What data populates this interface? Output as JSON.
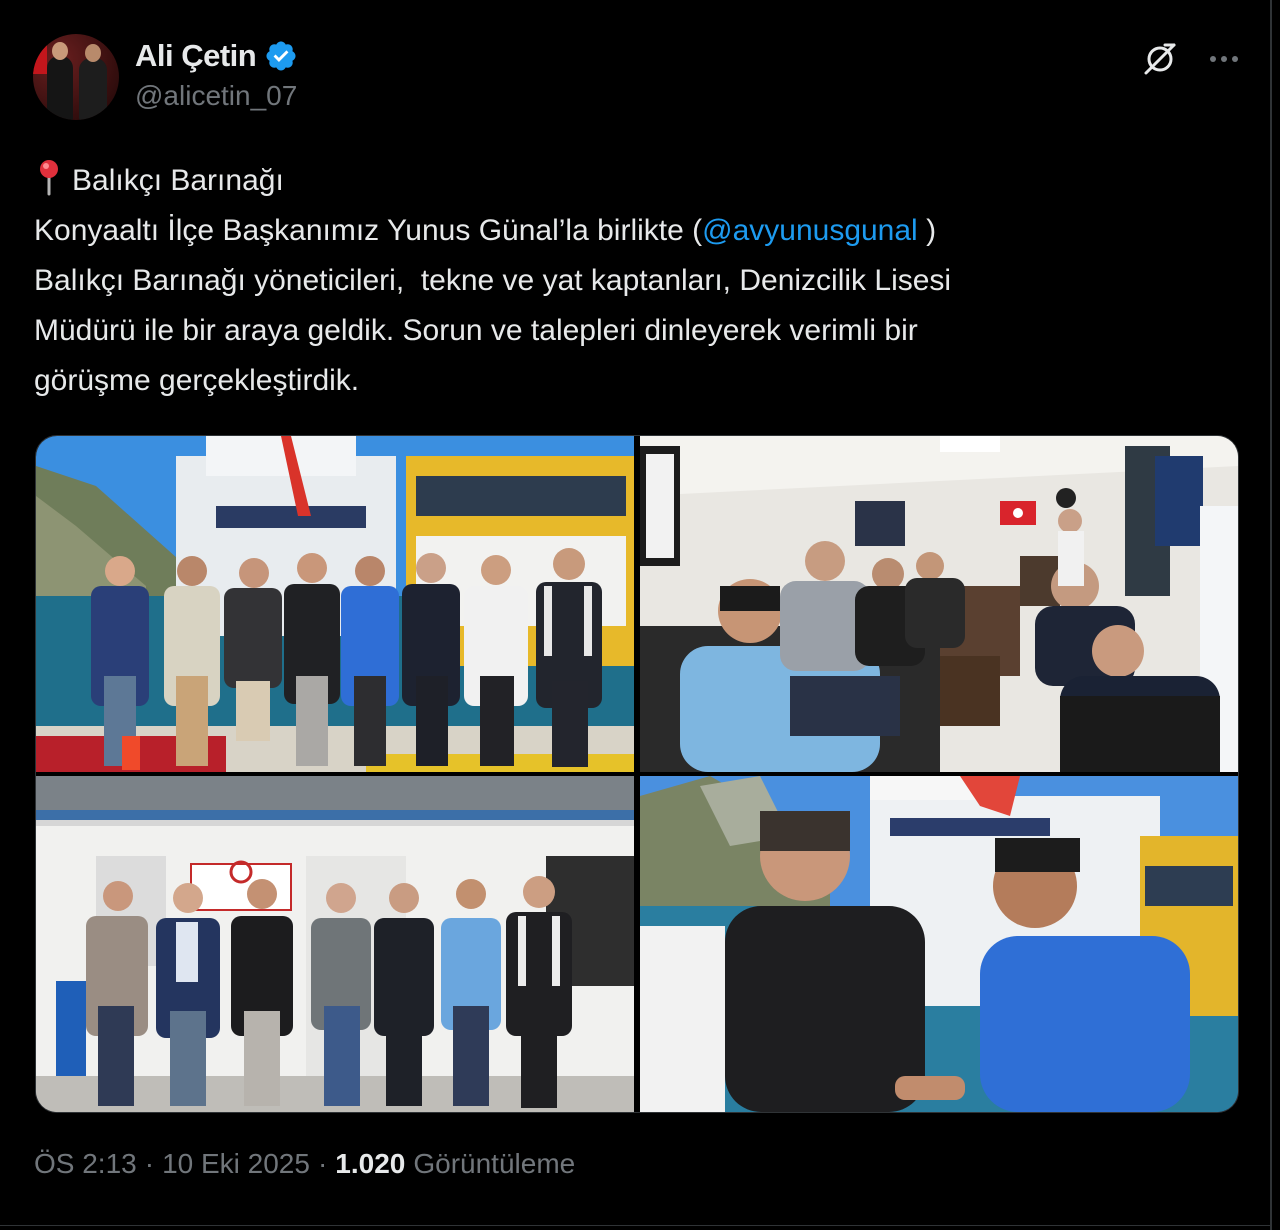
{
  "author": {
    "display_name": "Ali Çetin",
    "handle": "@alicetin_07",
    "verified": true
  },
  "icons": {
    "verified": "verified-badge-icon",
    "grok": "grok-icon",
    "more": "more-options-icon",
    "location": "round-pushpin-icon"
  },
  "tweet": {
    "line1": "Balıkçı Barınağı",
    "line2_before": "Konyaaltı İlçe Başkanımız Yunus Günal’la birlikte (",
    "mention": "@avyunusgunal",
    "line2_after": " )",
    "line3": "Balıkçı Barınağı yöneticileri,  tekne ve yat kaptanları, Denizcilik Lisesi",
    "line4": "Müdürü ile bir araya geldik. Sorun ve talepleri dinleyerek verimli bir",
    "line5": "görüşme gerçekleştirdik."
  },
  "media": {
    "count": 4
  },
  "meta": {
    "time": "ÖS 2:13",
    "sep1": "·",
    "date": "10 Eki 2025",
    "sep2": "·",
    "views_count": "1.020",
    "views_label": "Görüntüleme"
  },
  "colors": {
    "background": "#000000",
    "text": "#e7e9ea",
    "muted": "#71767b",
    "link": "#1d9bf0",
    "verified": "#1d9bf0",
    "border": "#2f3336"
  }
}
